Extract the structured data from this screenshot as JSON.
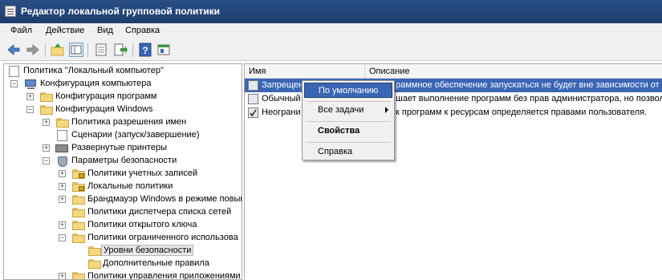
{
  "window": {
    "title": "Редактор локальной групповой политики"
  },
  "menu": [
    "Файл",
    "Действие",
    "Вид",
    "Справка"
  ],
  "tree": {
    "root": "Политика \"Локальный компьютер\"",
    "items": [
      {
        "label": "Конфигурация компьютера"
      },
      {
        "label": "Конфигурация программ"
      },
      {
        "label": "Конфигурация Windows"
      },
      {
        "label": "Политика разрешения имен"
      },
      {
        "label": "Сценарии (запуск/завершение)"
      },
      {
        "label": "Развернутые принтеры"
      },
      {
        "label": "Параметры безопасности"
      },
      {
        "label": "Политики учетных записей"
      },
      {
        "label": "Локальные политики"
      },
      {
        "label": "Брандмауэр Windows в режиме повыш"
      },
      {
        "label": "Политики диспетчера списка сетей"
      },
      {
        "label": "Политики открытого ключа"
      },
      {
        "label": "Политики ограниченного использова"
      },
      {
        "label": "Уровни безопасности"
      },
      {
        "label": "Дополнительные правила"
      },
      {
        "label": "Политики управления приложениями"
      }
    ]
  },
  "list": {
    "columns": [
      "Имя",
      "Описание"
    ],
    "rows": [
      {
        "name": "Запрещен",
        "description": "раммное обеспечение запускаться не будет вне зависимости от пр"
      },
      {
        "name": "Обычный",
        "description": "шает выполнение программ без прав администратора, но позволя"
      },
      {
        "name": "Неограни",
        "description": "к программ к ресурсам определяется правами пользователя."
      }
    ]
  },
  "context_menu": {
    "items": [
      "По умолчанию",
      "Все задачи",
      "Свойства",
      "Справка"
    ]
  },
  "colors": {
    "title_bar": "#1e3d6d",
    "selection": "#3a66b5"
  }
}
